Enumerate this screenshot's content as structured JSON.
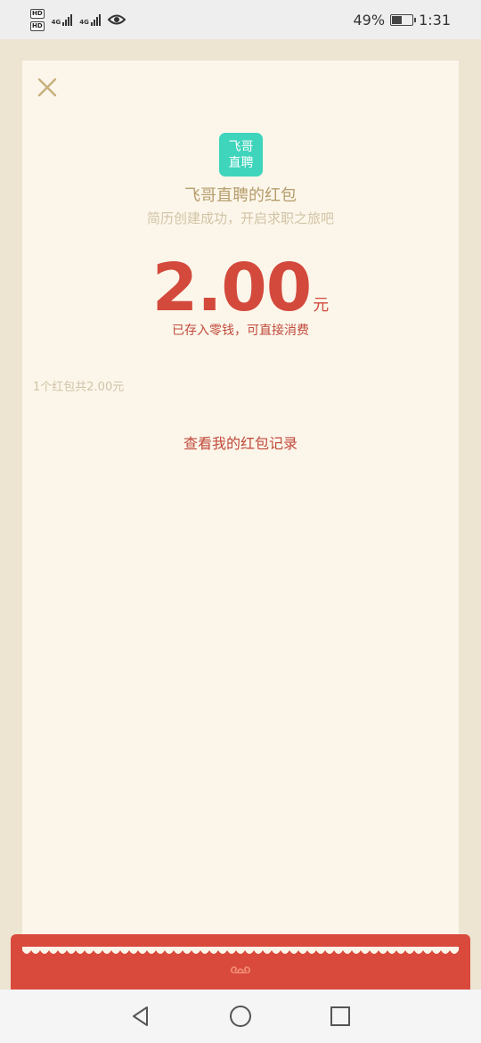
{
  "status": {
    "hd1": "HD",
    "hd2": "HD",
    "net1": "4G",
    "net2": "4G",
    "battery_percent": "49%",
    "battery_level": 0.49,
    "time": "1:31",
    "icons": [
      "hd-icon",
      "signal-icon",
      "eye-icon",
      "battery-icon"
    ]
  },
  "header": {
    "close_icon": "close-icon"
  },
  "app": {
    "logo_line1": "飞哥",
    "logo_line2": "直聘",
    "title": "飞哥直聘的红包",
    "subtitle": "简历创建成功，开启求职之旅吧"
  },
  "redpacket": {
    "amount": "2.00",
    "unit": "元",
    "stored_text": "已存入零钱，可直接消费",
    "summary": "1个红包共2.00元",
    "records_link": "查看我的红包记录"
  },
  "colors": {
    "accent_red": "#d34a3d",
    "gold_text": "#b59d6c",
    "card_bg": "#fcf6ea",
    "page_bg": "#ede4d2",
    "logo_bg": "#3fd4bc"
  },
  "navigation": {
    "icons": [
      "back-icon",
      "home-icon",
      "recents-icon"
    ]
  }
}
